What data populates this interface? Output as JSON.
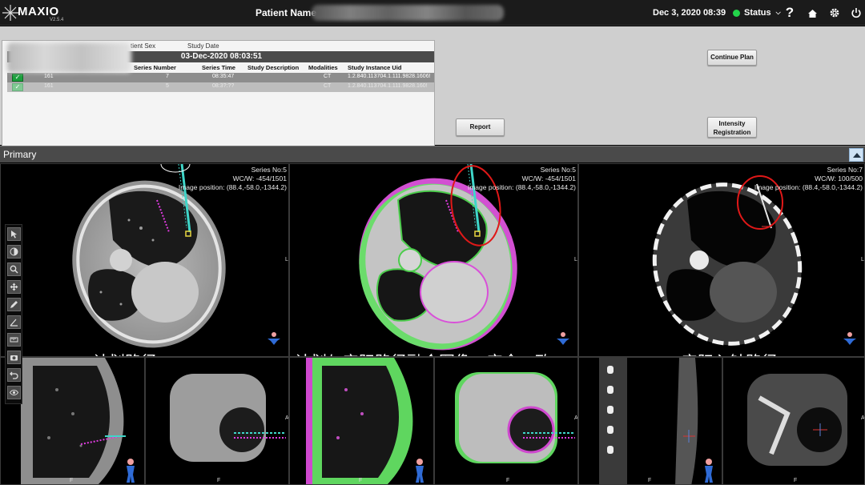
{
  "app": {
    "logo_text": "MAXIO",
    "version": "V2.5.4"
  },
  "header": {
    "patient_label": "Patient Name",
    "datetime": "Dec 3, 2020 08:39",
    "status_label": "Status",
    "status_color": "#23d44a",
    "icons": [
      "help-icon",
      "home-icon",
      "settings-icon",
      "power-icon"
    ]
  },
  "study_table": {
    "header_labels": [
      "tient Sex",
      "Study Date"
    ],
    "date_group": "03-Dec-2020 08:03:51",
    "columns": [
      "Series Number",
      "Series Time",
      "Study Description",
      "Modalities",
      "Study Instance Uid"
    ],
    "rows": [
      {
        "checked": true,
        "col0": "161",
        "series_number": "7",
        "series_time": "08:35:47",
        "study_description": "",
        "modalities": "CT",
        "uid": "1.2.840.113704.1.111.9828.1606!"
      },
      {
        "checked": true,
        "col0": "161",
        "series_number": "5",
        "series_time": "08:3?:??",
        "study_description": "",
        "modalities": "CT",
        "uid": "1.2.840.113704.1.111.9828.160!"
      }
    ]
  },
  "buttons": {
    "continue_plan": "Continue Plan",
    "report": "Report",
    "intensity_registration_1": "Intensity",
    "intensity_registration_2": "Registration"
  },
  "primary_label": "Primary",
  "viewports": [
    {
      "series": "Series No:5",
      "wcww": "WC/W: -454/1501",
      "position": "Image position: (88.4,-58.0,-1344.2)",
      "caption": "计划路径"
    },
    {
      "series": "Series No:5",
      "wcww": "WC/W: -454/1501",
      "position": "Image position: (88.4,-58.0,-1344.2)",
      "caption": "计划与实际路径融合图像：完全一致"
    },
    {
      "series": "Series No:7",
      "wcww": "WC/W: 100/500",
      "position": "Image position: (88.4,-58.0,-1344.2)",
      "caption": "实际入针路径"
    }
  ],
  "orientation": {
    "left": "L",
    "anterior": "A",
    "foot": "F"
  },
  "toolbar_tools": [
    "pointer-tool",
    "contrast-tool",
    "zoom-tool",
    "pan-tool",
    "measure-tool",
    "angle-tool",
    "ruler-tool",
    "screenshot-tool",
    "undo-tool",
    "visibility-tool"
  ]
}
